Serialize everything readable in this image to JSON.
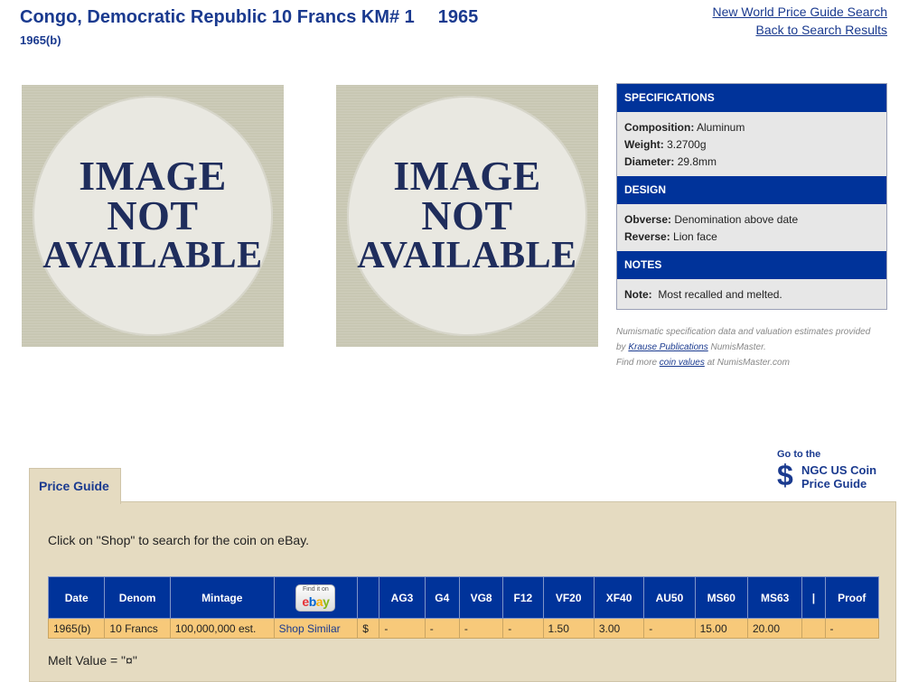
{
  "header": {
    "title": "Congo, Democratic Republic 10 Francs KM# 1",
    "year": "1965",
    "subtitle": "1965(b)",
    "links": {
      "search": "New World Price Guide Search",
      "back": "Back to Search Results"
    }
  },
  "images": {
    "line1": "IMAGE",
    "line2": "NOT",
    "line3": "AVAILABLE"
  },
  "specs": {
    "specifications_title": "SPECIFICATIONS",
    "composition_label": "Composition:",
    "composition": "Aluminum",
    "weight_label": "Weight:",
    "weight": "3.2700g",
    "diameter_label": "Diameter:",
    "diameter": "29.8mm",
    "design_title": "DESIGN",
    "obverse_label": "Obverse:",
    "obverse": "Denomination above date",
    "reverse_label": "Reverse:",
    "reverse": "Lion face",
    "notes_title": "NOTES",
    "note_label": "Note:",
    "note": "Most recalled and melted."
  },
  "credits": {
    "line1": "Numismatic specification data and valuation estimates provided",
    "by": "by",
    "krause": "Krause Publications",
    "numismaster": "NumisMaster.",
    "find_more": "Find more",
    "coin_values": "coin values",
    "at": "at NumisMaster.com"
  },
  "ngc": {
    "goto": "Go to the",
    "dollar": "$",
    "line1": "NGC US Coin",
    "line2": "Price Guide"
  },
  "price_guide": {
    "tab_label": "Price Guide",
    "instructions": "Click on \"Shop\" to search for the coin on eBay.",
    "ebay_find": "Find it on",
    "ebay_logo": [
      "e",
      "b",
      "a",
      "y"
    ],
    "columns": [
      "Date",
      "Denom",
      "Mintage",
      "",
      "",
      "AG3",
      "G4",
      "VG8",
      "F12",
      "VF20",
      "XF40",
      "AU50",
      "MS60",
      "MS63",
      "|",
      "Proof"
    ],
    "row": {
      "date": "1965(b)",
      "denom": "10 Francs",
      "mintage": "100,000,000 est.",
      "shop": "Shop Similar",
      "currency": "$",
      "ag3": "-",
      "g4": "-",
      "vg8": "-",
      "f12": "-",
      "vf20": "1.50",
      "xf40": "3.00",
      "au50": "-",
      "ms60": "15.00",
      "ms63": "20.00",
      "sep": "",
      "proof": "-"
    },
    "melt": "Melt Value = \"¤\""
  }
}
